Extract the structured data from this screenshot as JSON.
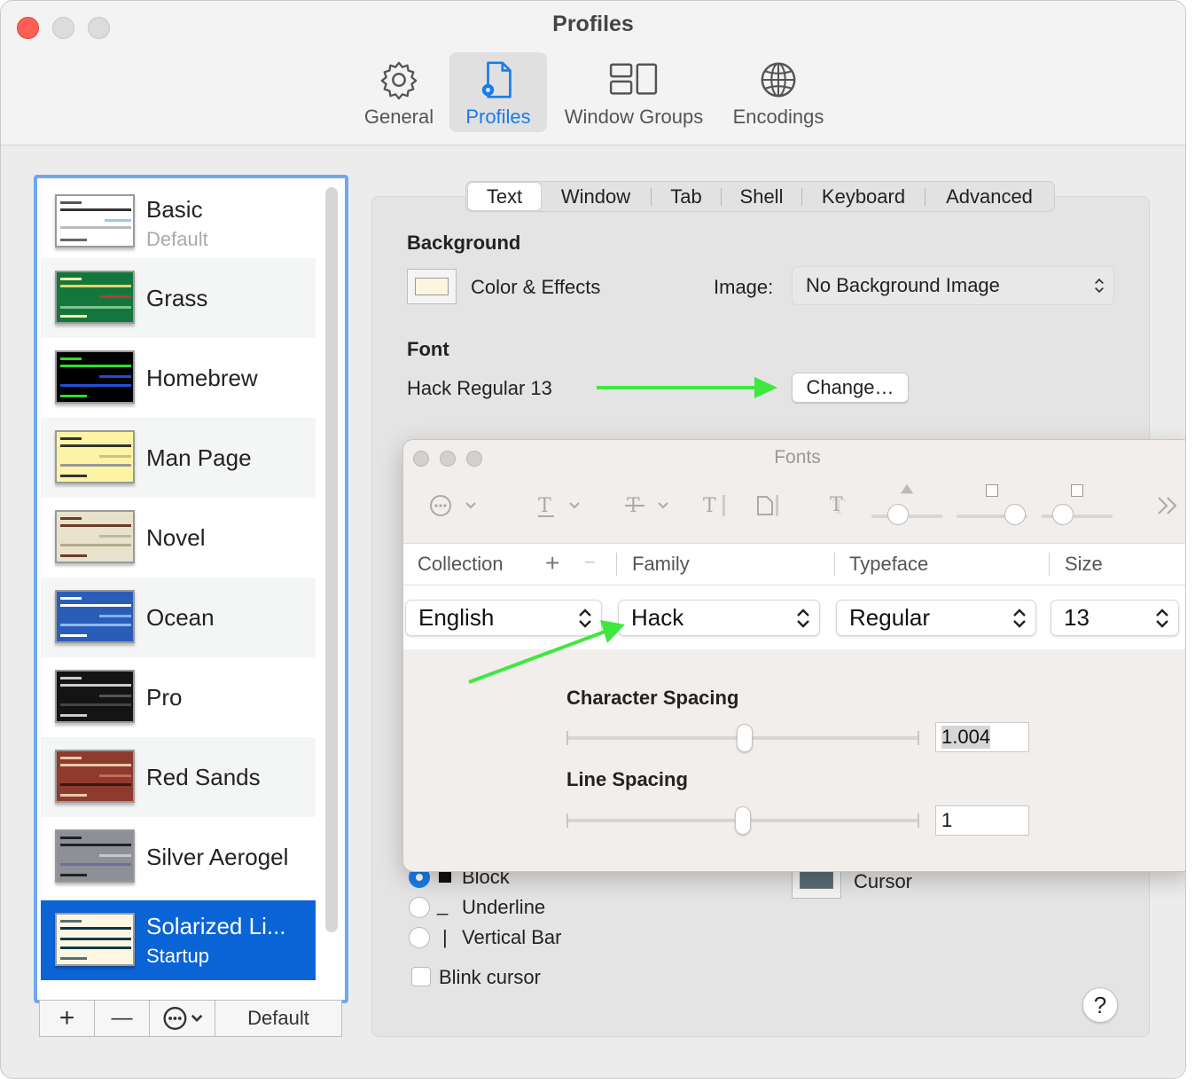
{
  "window": {
    "title": "Profiles"
  },
  "toolbar": {
    "items": [
      {
        "label": "General",
        "icon": "gear-icon"
      },
      {
        "label": "Profiles",
        "icon": "profile-document-icon",
        "active": true
      },
      {
        "label": "Window Groups",
        "icon": "window-groups-icon"
      },
      {
        "label": "Encodings",
        "icon": "globe-icon"
      }
    ]
  },
  "profiles": [
    {
      "name": "Basic",
      "subtitle": "Default"
    },
    {
      "name": "Grass"
    },
    {
      "name": "Homebrew"
    },
    {
      "name": "Man Page"
    },
    {
      "name": "Novel"
    },
    {
      "name": "Ocean"
    },
    {
      "name": "Pro"
    },
    {
      "name": "Red Sands"
    },
    {
      "name": "Silver Aerogel"
    },
    {
      "name": "Solarized Li...",
      "subtitle": "Startup",
      "selected": true
    }
  ],
  "list_toolbar": {
    "add": "+",
    "remove": "—",
    "default_label": "Default"
  },
  "tabs": [
    "Text",
    "Window",
    "Tab",
    "Shell",
    "Keyboard",
    "Advanced"
  ],
  "background": {
    "heading": "Background",
    "color_effects_label": "Color & Effects",
    "image_label": "Image:",
    "image_value": "No Background Image"
  },
  "font": {
    "heading": "Font",
    "current": "Hack Regular 13",
    "change_button": "Change…"
  },
  "cursor": {
    "options": [
      "Block",
      "Underline",
      "Vertical Bar"
    ],
    "underline_glyph": "_",
    "bar_glyph": "|",
    "color_label": "Cursor",
    "blink_label": "Blink cursor"
  },
  "help_glyph": "?",
  "fonts_panel": {
    "title": "Fonts",
    "columns": [
      "Collection",
      "Family",
      "Typeface",
      "Size"
    ],
    "collection_add": "+",
    "collection_remove": "−",
    "collection": "English",
    "family": "Hack",
    "typeface": "Regular",
    "size": "13",
    "character_spacing_label": "Character Spacing",
    "character_spacing": "1.004",
    "line_spacing_label": "Line Spacing",
    "line_spacing": "1"
  },
  "colors": {
    "accent": "#0b64d6",
    "annotation_arrow": "#3ee83e"
  }
}
